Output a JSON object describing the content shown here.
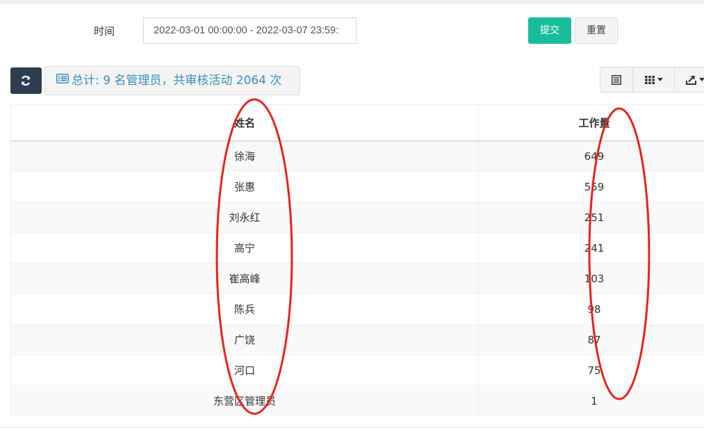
{
  "filter": {
    "time_label": "时间",
    "date_range_value": "2022-03-01 00:00:00 - 2022-03-07 23:59:",
    "submit_label": "提交",
    "reset_label": "重置"
  },
  "toolbar": {
    "refresh_icon": "refresh-icon",
    "summary_prefix": "总计:",
    "summary_text": " 9 名管理员，共审核活动 2064 次",
    "summary_color": "#3c8dbc"
  },
  "table": {
    "columns": [
      "姓名",
      "工作量"
    ],
    "rows": [
      {
        "name": "徐海",
        "workload": "649"
      },
      {
        "name": "张惠",
        "workload": "559"
      },
      {
        "name": "刘永红",
        "workload": "251"
      },
      {
        "name": "高宁",
        "workload": "241"
      },
      {
        "name": "崔高峰",
        "workload": "103"
      },
      {
        "name": "陈兵",
        "workload": "98"
      },
      {
        "name": "广饶",
        "workload": "87"
      },
      {
        "name": "河口",
        "workload": "75"
      },
      {
        "name": "东营区管理员",
        "workload": "1"
      }
    ]
  },
  "colors": {
    "submit": "#18bc9c",
    "refresh": "#2c3e50",
    "annotation": "#e8221c"
  }
}
